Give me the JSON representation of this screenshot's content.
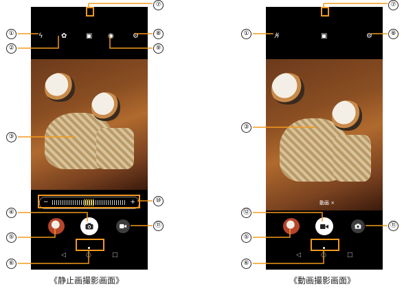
{
  "captions": {
    "photo": "《静止画撮影画面》",
    "video": "《動画撮影画面》"
  },
  "callouts": {
    "n1": "①",
    "n2": "②",
    "n3": "③",
    "n4": "④",
    "n5": "⑤",
    "n6": "⑥",
    "n7": "⑦",
    "n8": "⑧",
    "n9": "⑨",
    "n10": "⑩",
    "n11": "⑪",
    "n12": "⑫"
  },
  "photo_screen": {
    "zoom_minus": "−",
    "zoom_plus": "+",
    "icons": [
      "flash-icon",
      "timer-icon",
      "capture-mode-icon",
      "shooting-mode-icon",
      "settings-icon"
    ]
  },
  "video_screen": {
    "mode_label": "動画 ×",
    "icons": [
      "flash-off-icon",
      "capture-mode-icon",
      "settings-icon"
    ]
  },
  "colors": {
    "highlight": "#f39a1e",
    "screen_bg": "#000000",
    "shutter": "#ffffff"
  }
}
